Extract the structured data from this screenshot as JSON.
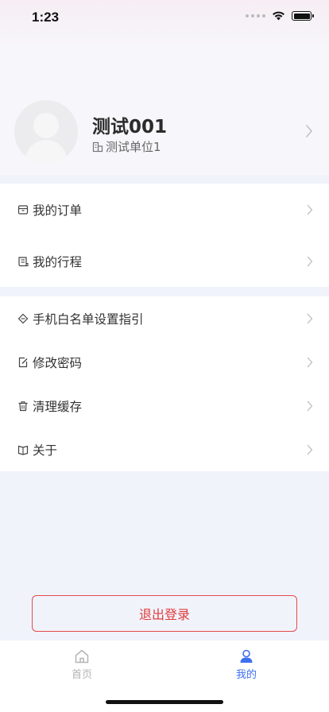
{
  "status_bar": {
    "time": "1:23"
  },
  "profile": {
    "name": "测试001",
    "organization": "测试单位1"
  },
  "menu": {
    "section1": [
      {
        "label": "我的订单",
        "icon": "box-icon"
      },
      {
        "label": "我的行程",
        "icon": "itinerary-icon"
      }
    ],
    "section2": [
      {
        "label": "手机白名单设置指引",
        "icon": "tag-icon"
      },
      {
        "label": "修改密码",
        "icon": "edit-icon"
      },
      {
        "label": "清理缓存",
        "icon": "trash-icon"
      },
      {
        "label": "关于",
        "icon": "book-icon"
      }
    ]
  },
  "logout_button": {
    "label": "退出登录"
  },
  "tabbar": {
    "tabs": [
      {
        "label": "首页",
        "icon": "home-icon",
        "active": false
      },
      {
        "label": "我的",
        "icon": "user-icon",
        "active": true
      }
    ]
  },
  "colors": {
    "accent": "#3d6ff0",
    "danger": "#e03c3c",
    "page_background": "#f1f3fb"
  }
}
